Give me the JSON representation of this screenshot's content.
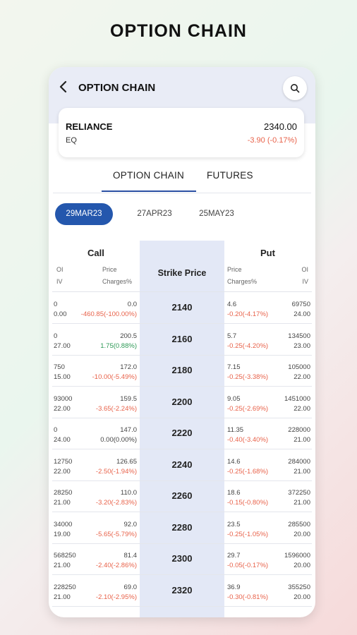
{
  "promo": {
    "title": "OPTION CHAIN"
  },
  "topbar": {
    "title": "OPTION CHAIN",
    "back_icon": "arrow-left-icon",
    "search_icon": "search-icon"
  },
  "stock": {
    "name": "RELIANCE",
    "segment": "EQ",
    "price": "2340.00",
    "change": "-3.90 (-0.17%)"
  },
  "tabs": [
    {
      "label": "OPTION CHAIN",
      "active": true
    },
    {
      "label": "FUTURES",
      "active": false
    }
  ],
  "expiries": [
    {
      "label": "29MAR23",
      "active": true
    },
    {
      "label": "27APR23",
      "active": false
    },
    {
      "label": "25MAY23",
      "active": false
    }
  ],
  "headers": {
    "call": "Call",
    "put": "Put",
    "strike": "Strike Price",
    "oi": "OI",
    "iv": "IV",
    "price": "Price",
    "charges": "Charges%"
  },
  "colors": {
    "accent": "#2457ad",
    "negative": "#e8624a",
    "positive": "#2e9a57",
    "strike_bg": "#e3e8f6"
  },
  "rows": [
    {
      "c_oi": "0",
      "c_iv": "0.00",
      "c_price": "0.0",
      "c_chg": "-460.85(-100.00%)",
      "c_dir": "neg",
      "strike": "2140",
      "p_price": "4.6",
      "p_chg": "-0.20(-4.17%)",
      "p_dir": "neg",
      "p_oi": "69750",
      "p_iv": "24.00"
    },
    {
      "c_oi": "0",
      "c_iv": "27.00",
      "c_price": "200.5",
      "c_chg": "1.75(0.88%)",
      "c_dir": "pos",
      "strike": "2160",
      "p_price": "5.7",
      "p_chg": "-0.25(-4.20%)",
      "p_dir": "neg",
      "p_oi": "134500",
      "p_iv": "23.00"
    },
    {
      "c_oi": "750",
      "c_iv": "15.00",
      "c_price": "172.0",
      "c_chg": "-10.00(-5.49%)",
      "c_dir": "neg",
      "strike": "2180",
      "p_price": "7.15",
      "p_chg": "-0.25(-3.38%)",
      "p_dir": "neg",
      "p_oi": "105000",
      "p_iv": "22.00"
    },
    {
      "c_oi": "93000",
      "c_iv": "22.00",
      "c_price": "159.5",
      "c_chg": "-3.65(-2.24%)",
      "c_dir": "neg",
      "strike": "2200",
      "p_price": "9.05",
      "p_chg": "-0.25(-2.69%)",
      "p_dir": "neg",
      "p_oi": "1451000",
      "p_iv": "22.00"
    },
    {
      "c_oi": "0",
      "c_iv": "24.00",
      "c_price": "147.0",
      "c_chg": "0.00(0.00%)",
      "c_dir": "flat",
      "strike": "2220",
      "p_price": "11.35",
      "p_chg": "-0.40(-3.40%)",
      "p_dir": "neg",
      "p_oi": "228000",
      "p_iv": "21.00"
    },
    {
      "c_oi": "12750",
      "c_iv": "22.00",
      "c_price": "126.65",
      "c_chg": "-2.50(-1.94%)",
      "c_dir": "neg",
      "strike": "2240",
      "p_price": "14.6",
      "p_chg": "-0.25(-1.68%)",
      "p_dir": "neg",
      "p_oi": "284000",
      "p_iv": "21.00"
    },
    {
      "c_oi": "28250",
      "c_iv": "21.00",
      "c_price": "110.0",
      "c_chg": "-3.20(-2.83%)",
      "c_dir": "neg",
      "strike": "2260",
      "p_price": "18.6",
      "p_chg": "-0.15(-0.80%)",
      "p_dir": "neg",
      "p_oi": "372250",
      "p_iv": "21.00"
    },
    {
      "c_oi": "34000",
      "c_iv": "19.00",
      "c_price": "92.0",
      "c_chg": "-5.65(-5.79%)",
      "c_dir": "neg",
      "strike": "2280",
      "p_price": "23.5",
      "p_chg": "-0.25(-1.05%)",
      "p_dir": "neg",
      "p_oi": "285500",
      "p_iv": "20.00"
    },
    {
      "c_oi": "568250",
      "c_iv": "21.00",
      "c_price": "81.4",
      "c_chg": "-2.40(-2.86%)",
      "c_dir": "neg",
      "strike": "2300",
      "p_price": "29.7",
      "p_chg": "-0.05(-0.17%)",
      "p_dir": "neg",
      "p_oi": "1596000",
      "p_iv": "20.00"
    },
    {
      "c_oi": "228250",
      "c_iv": "21.00",
      "c_price": "69.0",
      "c_chg": "-2.10(-2.95%)",
      "c_dir": "neg",
      "strike": "2320",
      "p_price": "36.9",
      "p_chg": "-0.30(-0.81%)",
      "p_dir": "neg",
      "p_oi": "355250",
      "p_iv": "20.00"
    }
  ]
}
